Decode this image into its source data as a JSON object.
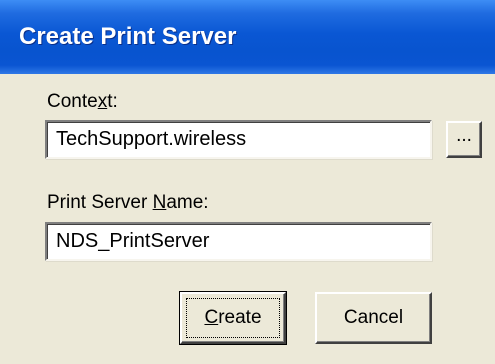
{
  "window": {
    "title": "Create Print Server"
  },
  "context": {
    "label_pre": "Conte",
    "label_accel": "x",
    "label_post": "t:",
    "value": "TechSupport.wireless",
    "browse_label": "..."
  },
  "print_server_name": {
    "label_pre": "Print Server ",
    "label_accel": "N",
    "label_post": "ame:",
    "value": "NDS_PrintServer"
  },
  "buttons": {
    "create_accel": "C",
    "create_rest": "reate",
    "cancel_label": "Cancel"
  },
  "colors": {
    "title_bar": "#0a57d4",
    "dialog_face": "#ece9d8"
  }
}
